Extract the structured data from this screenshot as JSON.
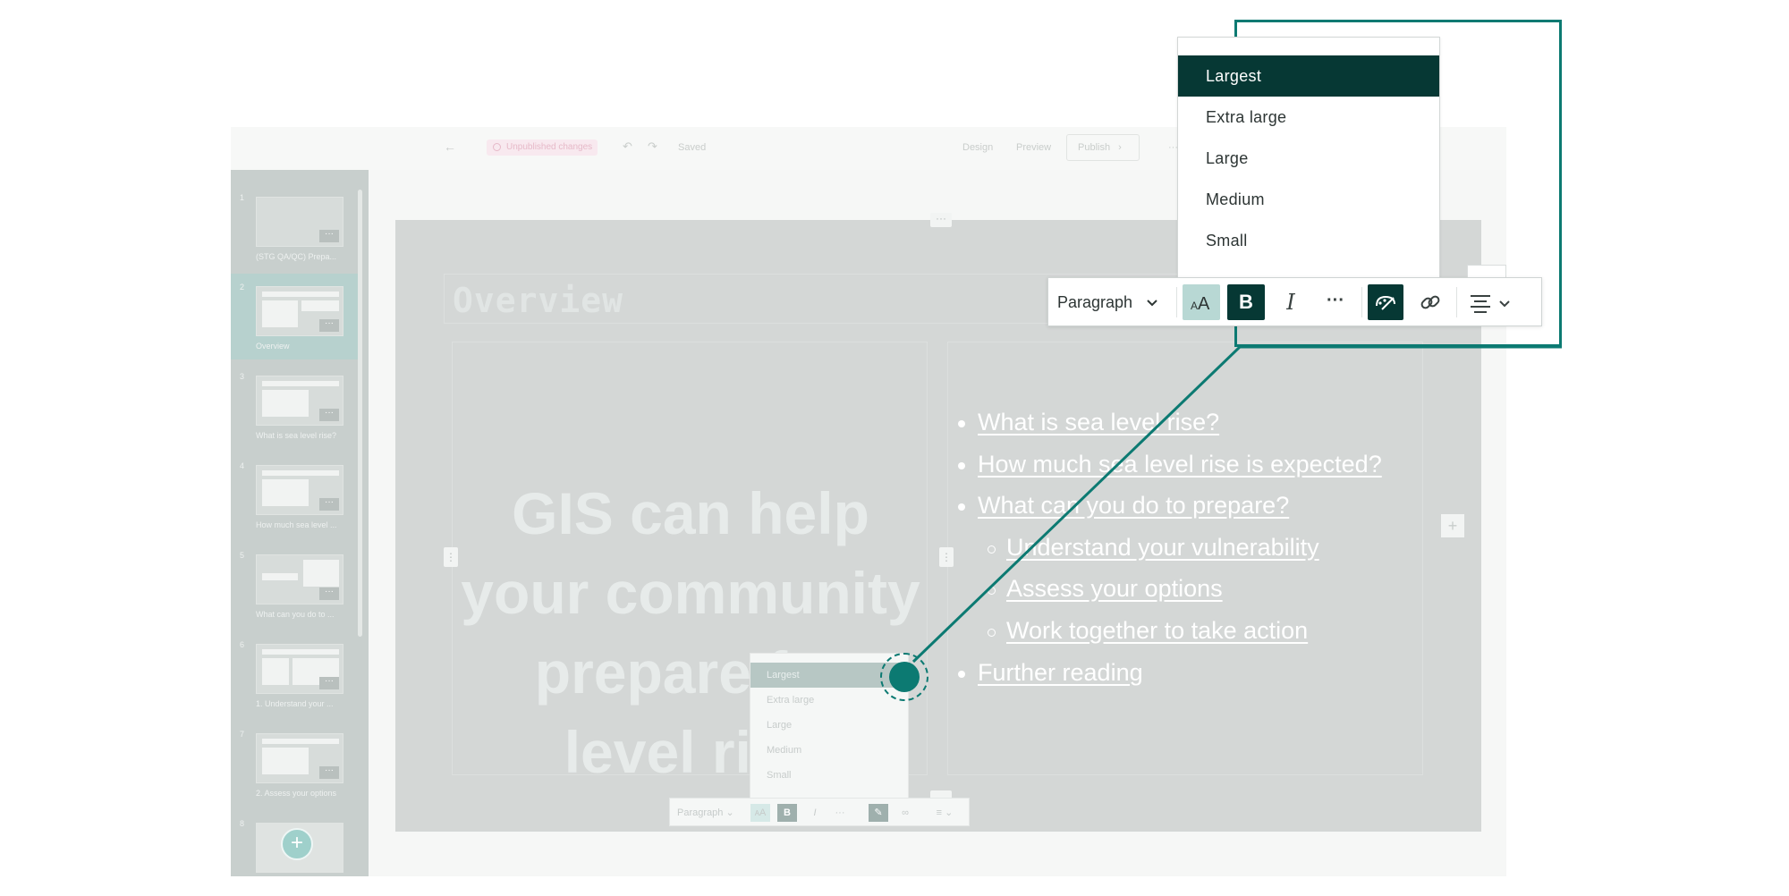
{
  "header": {
    "back_icon": "arrow-left-icon",
    "unpublished_label": "Unpublished changes",
    "saved_label": "Saved",
    "design_tab": "Design",
    "preview_tab": "Preview",
    "publish_label": "Publish",
    "more_label": "···"
  },
  "sidebar": {
    "items": [
      {
        "num": "1",
        "label": "(STG QA/QC) Prepa..."
      },
      {
        "num": "2",
        "label": "Overview"
      },
      {
        "num": "3",
        "label": "What is sea level rise?"
      },
      {
        "num": "4",
        "label": "How much sea level ..."
      },
      {
        "num": "5",
        "label": "What can you do to ..."
      },
      {
        "num": "6",
        "label": "1. Understand your ..."
      },
      {
        "num": "7",
        "label": "2. Assess your options"
      },
      {
        "num": "8",
        "label": ""
      }
    ],
    "more_label": "···",
    "add_label": "+"
  },
  "slide": {
    "heading": "Overview",
    "quote_lines": [
      "GIS can help",
      "your community",
      "prepare for",
      "level rise"
    ],
    "bullets": [
      "What is sea level rise?",
      "How much sea level rise is expected?",
      "What can you do to prepare?"
    ],
    "sub_bullets": [
      "Understand your vulnerability",
      "Assess your options",
      "Work together to take action"
    ],
    "last_bullet": "Further reading"
  },
  "small_menu": {
    "items": [
      "Largest",
      "Extra large",
      "Large",
      "Medium",
      "Small"
    ]
  },
  "small_toolbar": {
    "paragraph": "Paragraph",
    "bold": "B",
    "italic": "I",
    "more": "···"
  },
  "size_menu": {
    "selected": "Largest",
    "items": [
      "Largest",
      "Extra large",
      "Large",
      "Medium",
      "Small"
    ]
  },
  "toolbar": {
    "paragraph_label": "Paragraph",
    "bold_label": "B",
    "italic_label": "I",
    "more_label": "···"
  },
  "colors": {
    "accent": "#0c7a72",
    "selected_dark": "#063834",
    "selected_light": "#b8d8d4"
  }
}
